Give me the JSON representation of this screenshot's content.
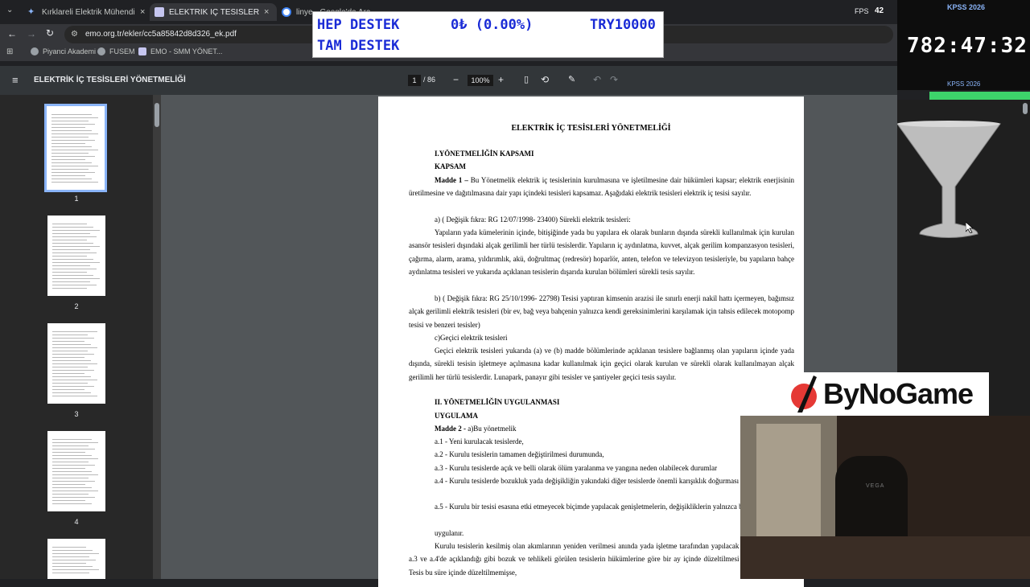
{
  "tabs": [
    {
      "title": "Kırklareli Elektrik Mühendisliği Ö"
    },
    {
      "title": "ELEKTRİK İÇ TESİSLERİ YÖNETM"
    },
    {
      "title": "linye - Google'da Ara"
    }
  ],
  "window": {
    "fps_label": "FPS",
    "fps_value": "42"
  },
  "address": {
    "url": "emo.org.tr/ekler/cc5a85842d8d326_ek.pdf"
  },
  "bookmarks": [
    "Piyanci Akademi",
    "FUSEM",
    "EMO - SMM YÖNET..."
  ],
  "pdf": {
    "title": "ELEKTRİK İÇ TESİSLERİ YÖNETMELİĞİ",
    "current_page": "1",
    "total_pages": "/ 86",
    "zoom": "100%"
  },
  "thumbnails": [
    "1",
    "2",
    "3",
    "4"
  ],
  "document": {
    "heading": "ELEKTRİK İÇ TESİSLERİ YÖNETMELİĞİ",
    "s1_title": "I.YÖNETMELİĞİN KAPSAMI",
    "s1_sub": "KAPSAM",
    "madde1_label": "Madde 1 –",
    "madde1_text": " Bu Yönetmelik elektrik iç tesislerinin kurulmasına ve işletilmesine dair hükümleri kapsar; elektrik enerjisinin üretilmesine ve dağıtılmasına dair yapı içindeki tesisleri kapsamaz. Aşağıdaki elektrik tesisleri elektrik iç tesisi sayılır.",
    "p_a": "a) ( Değişik fıkra: RG 12/07/1998- 23400) Sürekli elektrik tesisleri:",
    "p_a_body": "Yapıların yada kümelerinin içinde, bitişiğinde yada bu yapılara ek olarak bunların dışında sürekli kullanılmak için kurulan asansör tesisleri dışındaki alçak gerilimli her türlü tesislerdir. Yapıların iç aydınlatma, kuvvet, alçak gerilim kompanzasyon tesisleri, çağırma, alarm, arama, yıldırımlık, akü, doğrultmaç (redresör) hoparlör, anten, telefon ve televizyon tesisleriyle, bu yapıların bahçe aydınlatma tesisleri ve yukarıda açıklanan tesislerin dışarıda kurulan bölümleri sürekli tesis sayılır.",
    "p_b": "b) ( Değişik fıkra: RG 25/10/1996- 22798) Tesisi yaptıran kimsenin arazisi ile sınırlı enerji nakil hattı içermeyen, bağımsız alçak gerilimli elektrik tesisleri (bir ev, bağ veya bahçenin yalnızca kendi gereksinimlerini karşılamak için tahsis edilecek motopomp tesisi ve benzeri tesisler)",
    "p_c": "c)Geçici elektrik tesisleri",
    "p_c_body": "Geçici elektrik tesisleri yukarıda (a) ve (b) madde bölümlerinde açıklanan tesislere bağlanmış olan yapıların içinde yada dışında, sürekli tesisin işletmeye açılmasına kadar kullanılmak için geçici olarak kurulan ve sürekli olarak kullanılmayan alçak gerilimli her türlü tesislerdir. Lunapark, panayır gibi tesisler ve şantiyeler geçici tesis sayılır.",
    "s2_title": "II. YÖNETMELİĞİN UYGULANMASI",
    "s2_sub": "UYGULAMA",
    "madde2_label": "Madde 2 -",
    "madde2_text": " a)Bu yönetmelik",
    "a1": "a.1 - Yeni kurulacak tesislerde,",
    "a2": "a.2 - Kurulu tesislerin tamamen değiştirilmesi durumunda,",
    "a3": "a.3 - Kurulu tesislerde açık ve belli olarak ölüm yaralanma ve yangına neden olabilecek durumlar",
    "a4": "a.4 - Kurulu tesislerde bozukluk yada değişikliğin yakındaki diğer tesislerde önemli karışıklık doğurması durumunda,",
    "a5": "a.5 - Kurulu bir tesisi esasına etki etmeyecek biçimde yapılacak genişletmelerin, değişikliklerin yalnızca bu bölümlerinde,",
    "uygulanir": "uygulanır.",
    "last": "Kurulu tesislerin kesilmiş olan akımlarının yeniden verilmesi anında yada işletme tarafından yapılacak muayene sonunda a.3 ve a.4'de açıklandığı gibi bozuk ve tehlikeli görülen tesislerin hükümlerine göre bir ay içinde düzeltilmesi aboneye bildirilir. Tesis bu süre içinde düzeltilmemişse,"
  },
  "overlay_destek": {
    "line1": "HEP DESTEK",
    "amount": "0₺ (0.00%)",
    "target": "TRY10000",
    "line2": "TAM DESTEK"
  },
  "kpss": {
    "top_label": "KPSS 2026",
    "timer": "782:47:32",
    "bottom_label": "KPSS 2026"
  },
  "brand": {
    "name": "ByNoGame"
  },
  "webcam": {
    "chair_text": "VEGA"
  },
  "colors": {
    "accent": "#8ab4f8",
    "destek_text": "#1a2bd6",
    "progress": "#3dd46b"
  }
}
